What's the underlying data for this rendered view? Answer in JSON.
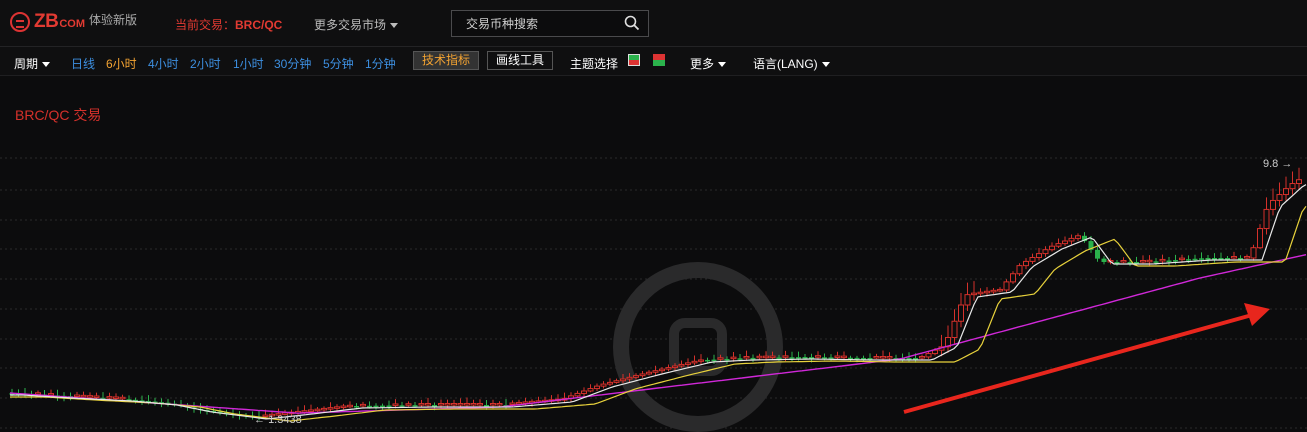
{
  "header": {
    "logo_text": "ZB",
    "logo_com": "COM",
    "logo_sub": "体验新版",
    "current_trade_label": "当前交易：",
    "current_trade_pair": "BRC/QC",
    "more_markets": "更多交易市场",
    "search_placeholder": "交易币种搜索"
  },
  "toolbar": {
    "period_label": "周期",
    "intervals": [
      "日线",
      "6小时",
      "4小时",
      "2小时",
      "1小时",
      "30分钟",
      "5分钟",
      "1分钟"
    ],
    "active_interval": "6小时",
    "indicators_btn": "技术指标",
    "draw_tools_btn": "画线工具",
    "theme_label": "主题选择",
    "more_label": "更多",
    "lang_label": "语言(LANG)"
  },
  "chart_data": {
    "type": "candlestick",
    "title": "BRC/QC 交易",
    "max_label": "9.8",
    "min_label": "1.3438",
    "colors": {
      "up": "#d5312b",
      "down": "#2bb24c",
      "ma_white": "#e8e8e8",
      "ma_yellow": "#e8d23c",
      "ma_magenta": "#d028d8",
      "arrow": "#e8261d"
    }
  }
}
